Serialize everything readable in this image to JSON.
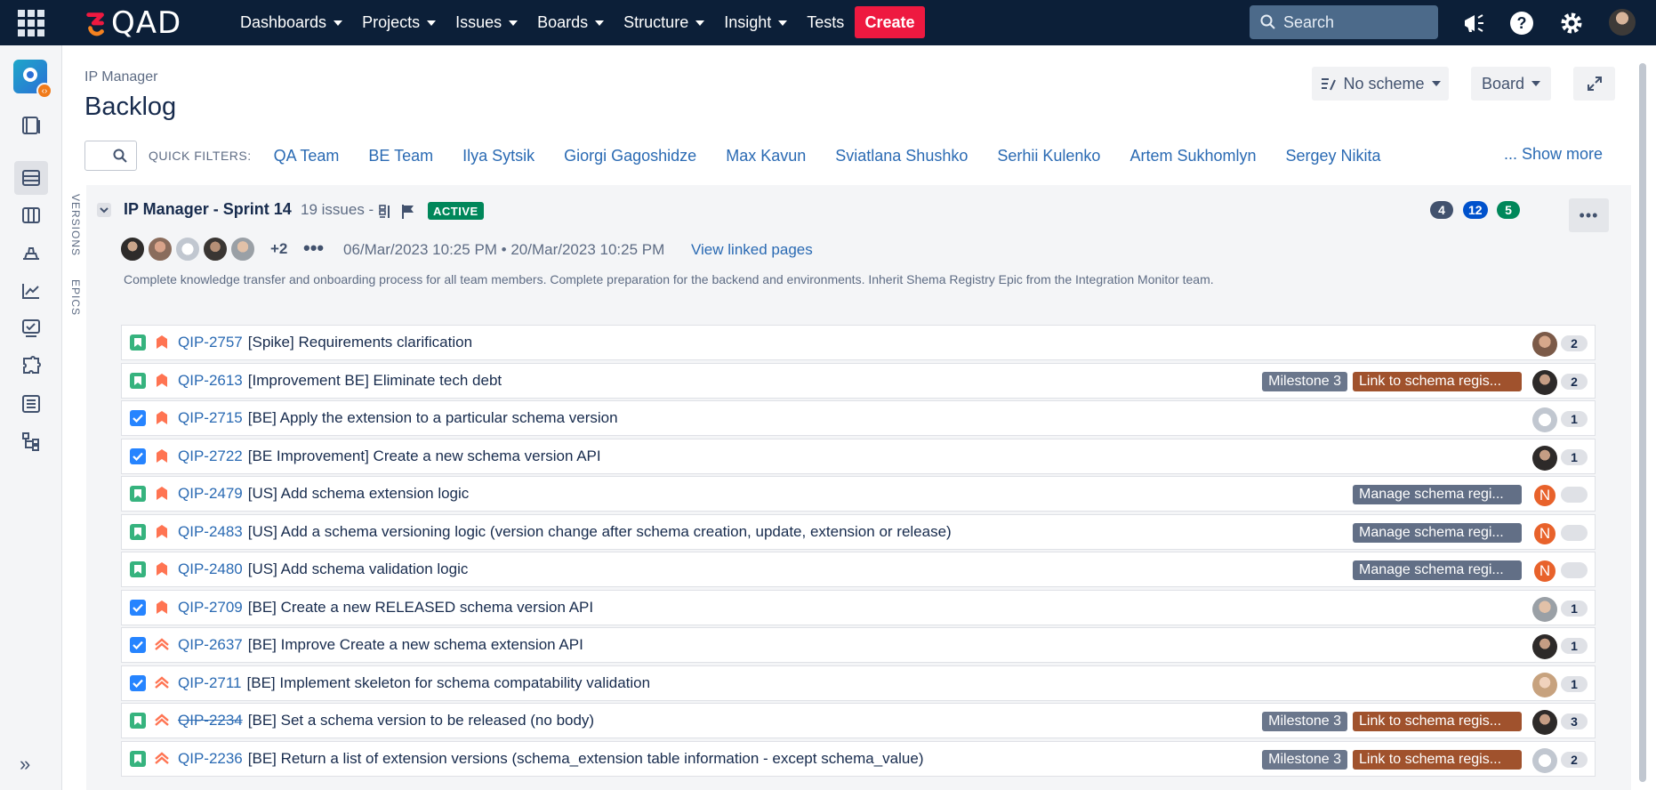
{
  "topnav": {
    "logo_text": "QAD",
    "menu": [
      {
        "label": "Dashboards",
        "dropdown": true
      },
      {
        "label": "Projects",
        "dropdown": true
      },
      {
        "label": "Issues",
        "dropdown": true
      },
      {
        "label": "Boards",
        "dropdown": true
      },
      {
        "label": "Structure",
        "dropdown": true
      },
      {
        "label": "Insight",
        "dropdown": true
      },
      {
        "label": "Tests",
        "dropdown": false
      }
    ],
    "create_label": "Create",
    "search_placeholder": "Search",
    "icons": [
      "app-switcher-icon",
      "megaphone-icon",
      "help-icon",
      "settings-icon",
      "profile-avatar"
    ],
    "create_color": "#ee1940",
    "bar_color": "#0c1f38"
  },
  "sidebar": {
    "icons": [
      "project-avatar-icon",
      "roadmap-icon",
      "backlog-icon",
      "board-icon",
      "releases-icon",
      "reports-icon",
      "issues-icon",
      "components-icon",
      "list-icon",
      "structure-icon"
    ],
    "active": "backlog-icon",
    "expand_icon": "expand-icon"
  },
  "side_tabs": [
    "VERSIONS",
    "EPICS"
  ],
  "header": {
    "breadcrumb": "IP Manager",
    "title": "Backlog",
    "scheme_label": "No scheme",
    "board_label": "Board"
  },
  "filters": {
    "label": "QUICK FILTERS:",
    "items": [
      "QA Team",
      "BE Team",
      "Ilya Sytsik",
      "Giorgi Gagoshidze",
      "Max Kavun",
      "Sviatlana Shushko",
      "Serhii Kulenko",
      "Artem Sukhomlyn",
      "Sergey Nikita"
    ],
    "show_more": "... Show more"
  },
  "sprint": {
    "name": "IP Manager - Sprint 14",
    "issue_count": "19 issues -",
    "status": "ACTIVE",
    "counts": [
      {
        "value": "4",
        "color": "#42526e"
      },
      {
        "value": "12",
        "color": "#0052cc"
      },
      {
        "value": "5",
        "color": "#00875a"
      }
    ],
    "more_assignees": "+2",
    "dates": "06/Mar/2023 10:25 PM  •  20/Mar/2023 10:25 PM",
    "linked_pages": "View linked pages",
    "goal": "Complete knowledge transfer and onboarding process for all team members. Complete preparation for the backend and environments. Inherit Shema Registry Epic from the Integration Monitor team."
  },
  "issues": [
    {
      "type": "story",
      "priority": "high",
      "key": "QIP-2757",
      "summary": "[Spike] Requirements clarification",
      "labels": [],
      "avatar": "a1",
      "estimate": "2",
      "done": false
    },
    {
      "type": "story",
      "priority": "high",
      "key": "QIP-2613",
      "summary": "[Improvement BE] Eliminate tech debt",
      "labels": [
        {
          "text": "Milestone 3",
          "kind": "ms"
        },
        {
          "text": "Link to schema regis...",
          "kind": "epic-brown"
        }
      ],
      "avatar": "a2",
      "estimate": "2",
      "done": false
    },
    {
      "type": "task",
      "priority": "high",
      "key": "QIP-2715",
      "summary": "[BE] Apply the extension to a particular schema version",
      "labels": [],
      "avatar": "a3",
      "estimate": "1",
      "done": false
    },
    {
      "type": "task",
      "priority": "high",
      "key": "QIP-2722",
      "summary": "[BE Improvement] Create a new schema version API",
      "labels": [],
      "avatar": "a2",
      "estimate": "1",
      "done": false
    },
    {
      "type": "story",
      "priority": "high",
      "key": "QIP-2479",
      "summary": "[US] Add schema extension logic",
      "labels": [
        {
          "text": "Manage schema regi...",
          "kind": "epic-slate"
        }
      ],
      "avatar": "n",
      "estimate": "",
      "done": false
    },
    {
      "type": "story",
      "priority": "high",
      "key": "QIP-2483",
      "summary": "[US] Add a schema versioning logic (version change after schema creation, update, extension or release)",
      "labels": [
        {
          "text": "Manage schema regi...",
          "kind": "epic-slate"
        }
      ],
      "avatar": "n",
      "estimate": "",
      "done": false
    },
    {
      "type": "story",
      "priority": "high",
      "key": "QIP-2480",
      "summary": "[US] Add schema validation logic",
      "labels": [
        {
          "text": "Manage schema regi...",
          "kind": "epic-slate"
        }
      ],
      "avatar": "n",
      "estimate": "",
      "done": false
    },
    {
      "type": "task",
      "priority": "high",
      "key": "QIP-2709",
      "summary": "[BE] Create a new RELEASED schema version API",
      "labels": [],
      "avatar": "a4",
      "estimate": "1",
      "done": false
    },
    {
      "type": "task",
      "priority": "highest",
      "key": "QIP-2637",
      "summary": "[BE] Improve Create a new schema extension API",
      "labels": [],
      "avatar": "a2",
      "estimate": "1",
      "done": false
    },
    {
      "type": "task",
      "priority": "highest",
      "key": "QIP-2711",
      "summary": "[BE] Implement skeleton for schema compatability validation",
      "labels": [],
      "avatar": "a5",
      "estimate": "1",
      "done": false
    },
    {
      "type": "story",
      "priority": "highest",
      "key": "QIP-2234",
      "summary": "[BE] Set a schema version to be released (no body)",
      "labels": [
        {
          "text": "Milestone 3",
          "kind": "ms"
        },
        {
          "text": "Link to schema regis...",
          "kind": "epic-brown"
        }
      ],
      "avatar": "a2",
      "estimate": "3",
      "done": true
    },
    {
      "type": "story",
      "priority": "highest",
      "key": "QIP-2236",
      "summary": "[BE] Return a list of extension versions (schema_extension table information - except schema_value)",
      "labels": [
        {
          "text": "Milestone 3",
          "kind": "ms"
        },
        {
          "text": "Link to schema regis...",
          "kind": "epic-brown"
        }
      ],
      "avatar": "a3",
      "estimate": "2",
      "done": false
    }
  ]
}
